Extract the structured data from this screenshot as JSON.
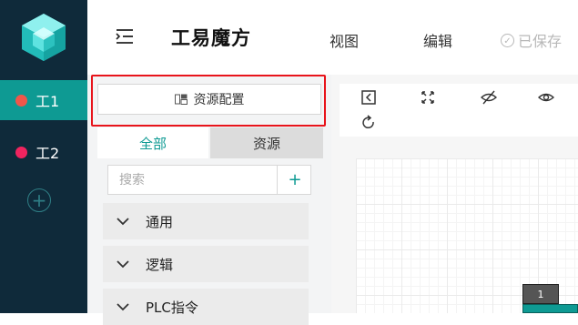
{
  "sidebar": {
    "projects": [
      {
        "label": "工1",
        "color": "#f0564a",
        "active": true
      },
      {
        "label": "工2",
        "color": "#f0245f",
        "active": false
      }
    ],
    "add_label": "+"
  },
  "header": {
    "title": "工易魔方",
    "menu": [
      "视图",
      "编辑"
    ],
    "saved_label": "已保存"
  },
  "left_panel": {
    "resource_button_label": "资源配置",
    "tabs": [
      {
        "label": "全部",
        "active": true
      },
      {
        "label": "资源",
        "active": false
      }
    ],
    "search_placeholder": "搜索",
    "add_label": "+",
    "categories": [
      "通用",
      "逻辑",
      "PLC指令"
    ]
  },
  "canvas": {
    "node_label": "1"
  },
  "colors": {
    "accent": "#0e9a93",
    "sidebar_bg": "#0f2a3a",
    "highlight": "#e8141b"
  },
  "icons": [
    "cube-logo-icon",
    "collapse-menu-icon",
    "check-circle-icon",
    "resource-icon",
    "chevron-down-icon",
    "fit-left-icon",
    "fullscreen-icon",
    "eye-off-icon",
    "eye-icon",
    "refresh-icon"
  ]
}
